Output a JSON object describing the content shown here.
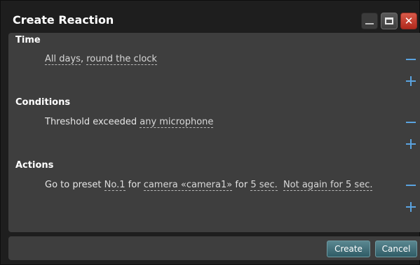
{
  "window": {
    "title": "Create Reaction"
  },
  "sections": {
    "time": {
      "title": "Time",
      "days": "All days",
      "sep": ",",
      "hours": "round the clock"
    },
    "conditions": {
      "title": "Conditions",
      "prefix": "Threshold exceeded",
      "target": "any microphone"
    },
    "actions": {
      "title": "Actions",
      "prefix": "Go to preset",
      "preset": "No.1",
      "for1": "for",
      "camera": "camera «camera1»",
      "for2": "for",
      "duration": "5 sec.",
      "again": "Not again for 5 sec."
    }
  },
  "controls": {
    "remove": "−",
    "add": "+"
  },
  "footer": {
    "create_label": "Create",
    "cancel_label": "Cancel"
  },
  "colors": {
    "accent": "#5aa3e0",
    "button": "#3f6e78",
    "panel": "#3e3e3e",
    "close": "#c0392b"
  }
}
